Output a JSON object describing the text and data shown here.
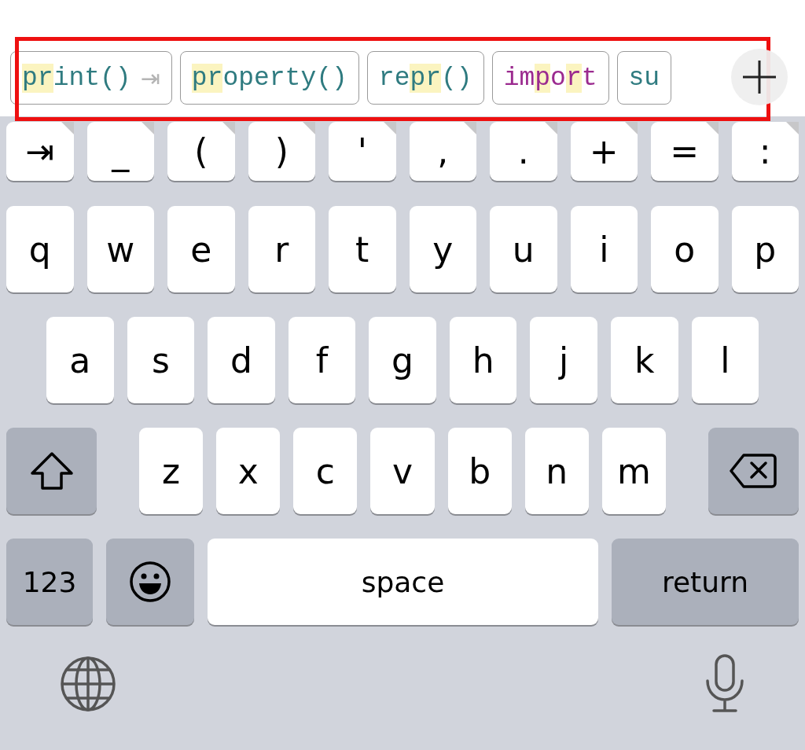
{
  "suggestions": [
    {
      "kind": "function",
      "segments": [
        {
          "text": "p",
          "match": true
        },
        {
          "text": "r",
          "match": true
        },
        {
          "text": "int()",
          "match": false
        }
      ],
      "hint": "⇥"
    },
    {
      "kind": "function",
      "segments": [
        {
          "text": "pr",
          "match": true
        },
        {
          "text": "operty()",
          "match": false
        }
      ]
    },
    {
      "kind": "function",
      "segments": [
        {
          "text": "re",
          "match": false
        },
        {
          "text": "pr",
          "match": true
        },
        {
          "text": "()",
          "match": false
        }
      ]
    },
    {
      "kind": "keyword",
      "segments": [
        {
          "text": "im",
          "match": false
        },
        {
          "text": "p",
          "match": true
        },
        {
          "text": "o",
          "match": false
        },
        {
          "text": "r",
          "match": true
        },
        {
          "text": "t",
          "match": false
        }
      ]
    },
    {
      "kind": "function",
      "segments": [
        {
          "text": "su",
          "match": false
        }
      ]
    }
  ],
  "rows": [
    [
      {
        "kind": "symbol",
        "label": "⇥"
      },
      {
        "kind": "symbol",
        "label": "_"
      },
      {
        "kind": "symbol",
        "label": "("
      },
      {
        "kind": "symbol",
        "label": ")"
      },
      {
        "kind": "symbol",
        "label": "'"
      },
      {
        "kind": "symbol",
        "label": ","
      },
      {
        "kind": "symbol",
        "label": "."
      },
      {
        "kind": "symbol",
        "label": "+"
      },
      {
        "kind": "symbol",
        "label": "="
      },
      {
        "kind": "symbol",
        "label": ":"
      }
    ],
    [
      {
        "kind": "letter",
        "label": "q"
      },
      {
        "kind": "letter",
        "label": "w"
      },
      {
        "kind": "letter",
        "label": "e"
      },
      {
        "kind": "letter",
        "label": "r"
      },
      {
        "kind": "letter",
        "label": "t"
      },
      {
        "kind": "letter",
        "label": "y"
      },
      {
        "kind": "letter",
        "label": "u"
      },
      {
        "kind": "letter",
        "label": "i"
      },
      {
        "kind": "letter",
        "label": "o"
      },
      {
        "kind": "letter",
        "label": "p"
      }
    ],
    [
      {
        "kind": "letter",
        "label": "a"
      },
      {
        "kind": "letter",
        "label": "s"
      },
      {
        "kind": "letter",
        "label": "d"
      },
      {
        "kind": "letter",
        "label": "f"
      },
      {
        "kind": "letter",
        "label": "g"
      },
      {
        "kind": "letter",
        "label": "h"
      },
      {
        "kind": "letter",
        "label": "j"
      },
      {
        "kind": "letter",
        "label": "k"
      },
      {
        "kind": "letter",
        "label": "l"
      }
    ],
    [
      {
        "kind": "shift"
      },
      {
        "kind": "letter",
        "label": "z"
      },
      {
        "kind": "letter",
        "label": "x"
      },
      {
        "kind": "letter",
        "label": "c"
      },
      {
        "kind": "letter",
        "label": "v"
      },
      {
        "kind": "letter",
        "label": "b"
      },
      {
        "kind": "letter",
        "label": "n"
      },
      {
        "kind": "letter",
        "label": "m"
      },
      {
        "kind": "backspace"
      }
    ],
    [
      {
        "kind": "numbers",
        "label": "123"
      },
      {
        "kind": "emoji"
      },
      {
        "kind": "space",
        "label": "space"
      },
      {
        "kind": "return",
        "label": "return"
      }
    ]
  ]
}
